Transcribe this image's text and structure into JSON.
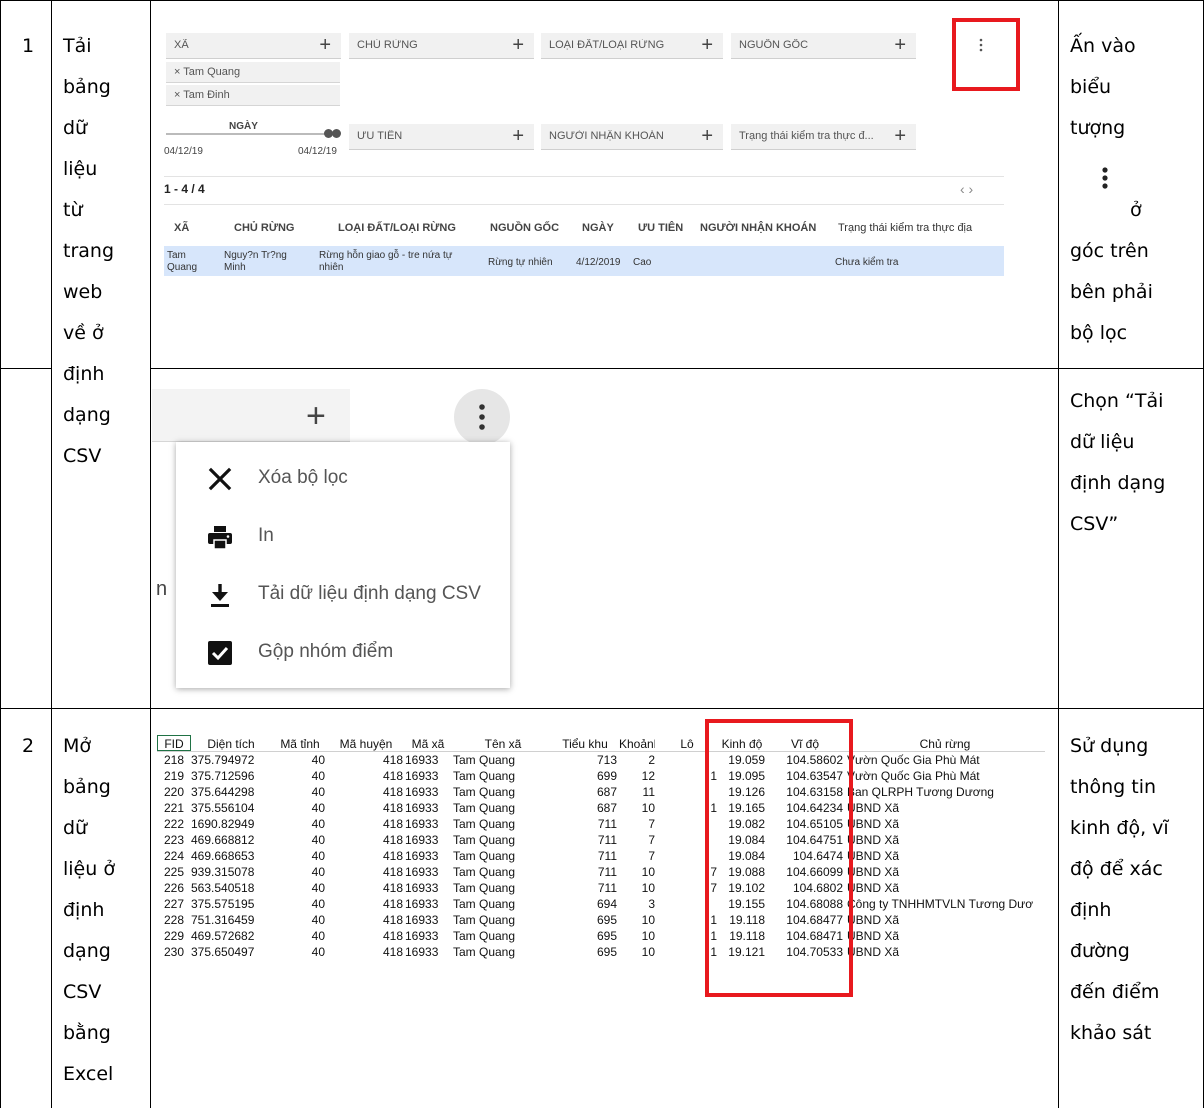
{
  "steps": [
    {
      "number": "1",
      "title_lines": [
        "Tải",
        "bảng",
        "dữ",
        "liệu",
        "từ",
        "trang",
        "web",
        "về ở",
        "định",
        "dạng",
        "CSV"
      ],
      "note1_lines_before": [
        "Ấn vào",
        "biểu",
        "tượng"
      ],
      "note1_icon": "vertical-dots-icon",
      "note1_lines_after": [
        "ở",
        "góc trên",
        "bên phải",
        "bộ lọc"
      ],
      "note2_lines": [
        "Chọn “Tải",
        "dữ liệu",
        "định dạng",
        "CSV”"
      ]
    },
    {
      "number": "2",
      "title_lines": [
        "Mở",
        "bảng",
        "dữ",
        "liệu ở",
        "định",
        "dạng",
        "CSV",
        "bằng",
        "Excel"
      ],
      "note_lines": [
        "Sử dụng",
        "thông tin",
        "kinh độ, vĩ",
        "độ để xác",
        "định",
        "đường",
        "đến điểm",
        "khảo sát"
      ]
    }
  ],
  "filter_ui": {
    "chips_row1": [
      "XÃ",
      "CHỦ RỪNG",
      "LOẠI ĐẤT/LOẠI RỪNG",
      "NGUỒN GỐC"
    ],
    "chips_row2": [
      "ƯU TIÊN",
      "NGƯỜI NHẬN KHOÁN",
      "Trạng thái kiểm tra thực đ..."
    ],
    "selected_tags": [
      "× Tam Quang",
      "× Tam Đinh"
    ],
    "date_label": "NGÀY",
    "date_from": "04/12/19",
    "date_to": "04/12/19",
    "pagination": "1 - 4 / 4",
    "pager_arrows": "‹  ›",
    "menu_icon": "vertical-dots-icon",
    "table_headers": [
      "XÃ",
      "CHỦ RỪNG",
      "LOẠI ĐẤT/LOẠI RỪNG",
      "NGUỒN GỐC",
      "NGÀY",
      "ƯU TIÊN",
      "NGƯỜI NHẬN KHOÁN",
      "Trạng thái kiểm tra thực địa"
    ],
    "table_row": {
      "xa": [
        "Tam",
        "Quang"
      ],
      "chu_rung": [
        "Nguy?n Tr?ng",
        "Minh"
      ],
      "loai_dat": [
        "Rừng hỗn giao gỗ - tre nứa tự",
        "nhiên"
      ],
      "nguon_goc": "Rừng tự nhiên",
      "ngay": "4/12/2019",
      "uu_tien": "Cao",
      "trang_thai": "Chưa kiểm tra"
    }
  },
  "menu": {
    "chip_plus": "+",
    "partial_text": "n",
    "items": [
      {
        "label": "Xóa bộ lọc",
        "icon": "close-icon"
      },
      {
        "label": "In",
        "icon": "printer-icon"
      },
      {
        "label": "Tải dữ liệu định dạng CSV",
        "icon": "download-icon"
      },
      {
        "label": "Gộp nhóm điểm",
        "icon": "checkbox-checked-icon"
      }
    ]
  },
  "spreadsheet": {
    "headers": [
      "FID",
      "Diện tích",
      "Mã tỉnh",
      "Mã huyện",
      "Mã xã",
      "Tên xã",
      "Tiểu khu",
      "Khoảnh",
      "Lô",
      "Kinh độ",
      "Vĩ độ",
      "Chủ rừng"
    ],
    "rows": [
      [
        "218",
        "375.794972",
        "40",
        "418",
        "16933",
        "Tam Quang",
        "713",
        "2",
        "",
        "19.059",
        "104.58602",
        "Vườn Quốc Gia Phù Mát"
      ],
      [
        "219",
        "375.712596",
        "40",
        "418",
        "16933",
        "Tam Quang",
        "699",
        "12",
        "1",
        "19.095",
        "104.63547",
        "Vườn Quốc Gia Phù Mát"
      ],
      [
        "220",
        "375.644298",
        "40",
        "418",
        "16933",
        "Tam Quang",
        "687",
        "11",
        "",
        "19.126",
        "104.63158",
        "Ban QLRPH Tương Dương"
      ],
      [
        "221",
        "375.556104",
        "40",
        "418",
        "16933",
        "Tam Quang",
        "687",
        "10",
        "1",
        "19.165",
        "104.64234",
        "UBND Xã"
      ],
      [
        "222",
        "1690.82949",
        "40",
        "418",
        "16933",
        "Tam Quang",
        "711",
        "7",
        "",
        "19.082",
        "104.65105",
        "UBND Xã"
      ],
      [
        "223",
        "469.668812",
        "40",
        "418",
        "16933",
        "Tam Quang",
        "711",
        "7",
        "",
        "19.084",
        "104.64751",
        "UBND Xã"
      ],
      [
        "224",
        "469.668653",
        "40",
        "418",
        "16933",
        "Tam Quang",
        "711",
        "7",
        "",
        "19.084",
        "104.6474",
        "UBND Xã"
      ],
      [
        "225",
        "939.315078",
        "40",
        "418",
        "16933",
        "Tam Quang",
        "711",
        "10",
        "7",
        "19.088",
        "104.66099",
        "UBND Xã"
      ],
      [
        "226",
        "563.540518",
        "40",
        "418",
        "16933",
        "Tam Quang",
        "711",
        "10",
        "7",
        "19.102",
        "104.6802",
        "UBND Xã"
      ],
      [
        "227",
        "375.575195",
        "40",
        "418",
        "16933",
        "Tam Quang",
        "694",
        "3",
        "",
        "19.155",
        "104.68088",
        "Công ty TNHHMTVLN Tương Dươ"
      ],
      [
        "228",
        "751.316459",
        "40",
        "418",
        "16933",
        "Tam Quang",
        "695",
        "10",
        "1",
        "19.118",
        "104.68477",
        "UBND Xã"
      ],
      [
        "229",
        "469.572682",
        "40",
        "418",
        "16933",
        "Tam Quang",
        "695",
        "10",
        "1",
        "19.118",
        "104.68471",
        "UBND Xã"
      ],
      [
        "230",
        "375.650497",
        "40",
        "418",
        "16933",
        "Tam Quang",
        "695",
        "10",
        "1",
        "19.121",
        "104.70533",
        "UBND Xã"
      ]
    ]
  },
  "colors": {
    "highlight_red": "#e8191e",
    "selected_row": "#d7e6fb"
  }
}
